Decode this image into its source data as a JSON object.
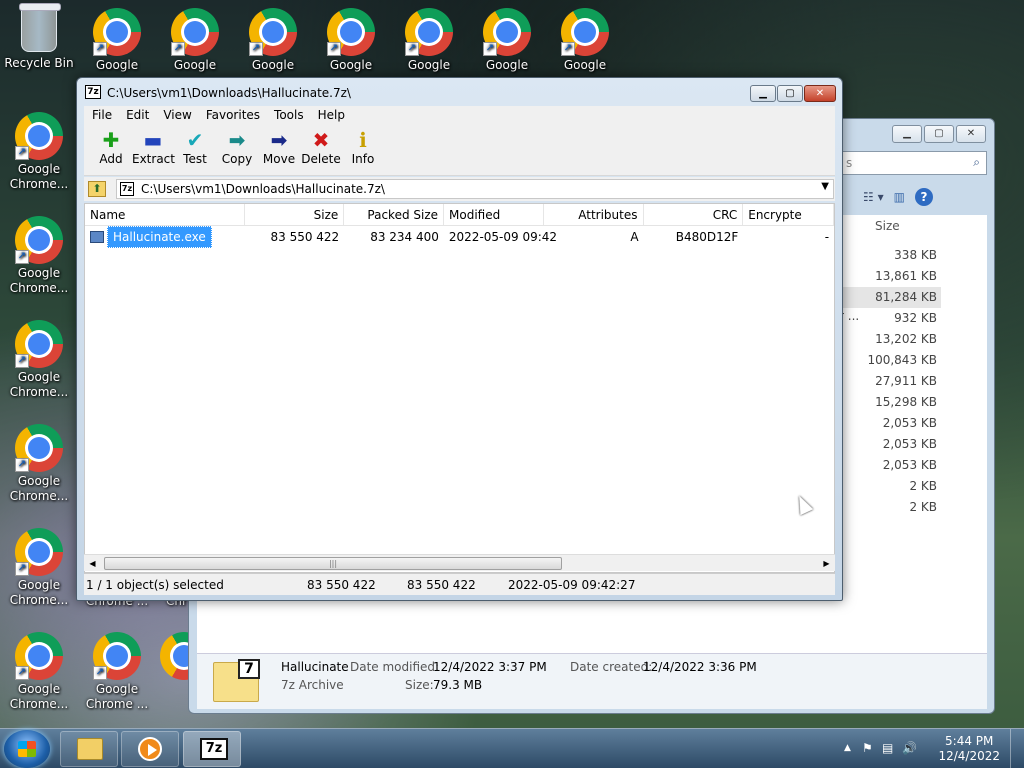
{
  "desktop": {
    "recycle_bin": "Recycle Bin",
    "top_row": [
      "Google",
      "Google",
      "Google",
      "Google",
      "Google",
      "Google",
      "Google"
    ],
    "left_column": [
      "Google Chrome...",
      "Google Chrome...",
      "Google Chrome...",
      "Google Chrome...",
      "Google Chrome...",
      "Google Chrome..."
    ],
    "bottom_extra": [
      "Google Chrome ..."
    ],
    "behind_labels": [
      "Chrome ...",
      "Chr"
    ]
  },
  "explorer": {
    "search_placeholder": "s",
    "size_header": "Size",
    "sizes": [
      "338 KB",
      "13,861 KB",
      "81,284 KB",
      "932 KB",
      "13,202 KB",
      "100,843 KB",
      "27,911 KB",
      "15,298 KB",
      "2,053 KB",
      "2,053 KB",
      "2,053 KB",
      "2 KB",
      "2 KB"
    ],
    "truncated_name": "r ...",
    "details": {
      "name": "Hallucinate",
      "type": "7z Archive",
      "date_modified_label": "Date modified:",
      "date_modified": "12/4/2022 3:37 PM",
      "date_created_label": "Date created:",
      "date_created": "12/4/2022 3:36 PM",
      "size_label": "Size:",
      "size": "79.3 MB",
      "icon_text": "7"
    }
  },
  "zip": {
    "title": "C:\\Users\\vm1\\Downloads\\Hallucinate.7z\\",
    "app_icon": "7z",
    "menu": [
      "File",
      "Edit",
      "View",
      "Favorites",
      "Tools",
      "Help"
    ],
    "toolbar": [
      {
        "label": "Add",
        "glyph": "✚",
        "color": "#1aa01a"
      },
      {
        "label": "Extract",
        "glyph": "▬",
        "color": "#2244bb"
      },
      {
        "label": "Test",
        "glyph": "✔",
        "color": "#18a8b8"
      },
      {
        "label": "Copy",
        "glyph": "➡",
        "color": "#1a8a8a"
      },
      {
        "label": "Move",
        "glyph": "➡",
        "color": "#1a2a8a"
      },
      {
        "label": "Delete",
        "glyph": "✖",
        "color": "#d01a1a"
      },
      {
        "label": "Info",
        "glyph": "ℹ",
        "color": "#c8a000"
      }
    ],
    "address": "C:\\Users\\vm1\\Downloads\\Hallucinate.7z\\",
    "columns": [
      "Name",
      "Size",
      "Packed Size",
      "Modified",
      "Attributes",
      "CRC",
      "Encrypte"
    ],
    "row": {
      "name": "Hallucinate.exe",
      "size": "83 550 422",
      "packed": "83 234 400",
      "modified": "2022-05-09 09:42",
      "attributes": "A",
      "crc": "B480D12F",
      "encrypted": "-"
    },
    "status": {
      "selected": "1 / 1 object(s) selected",
      "size1": "83 550 422",
      "size2": "83 550 422",
      "date": "2022-05-09 09:42:27"
    }
  },
  "taskbar": {
    "time": "5:44 PM",
    "date": "12/4/2022",
    "seven_zip": "7z"
  }
}
